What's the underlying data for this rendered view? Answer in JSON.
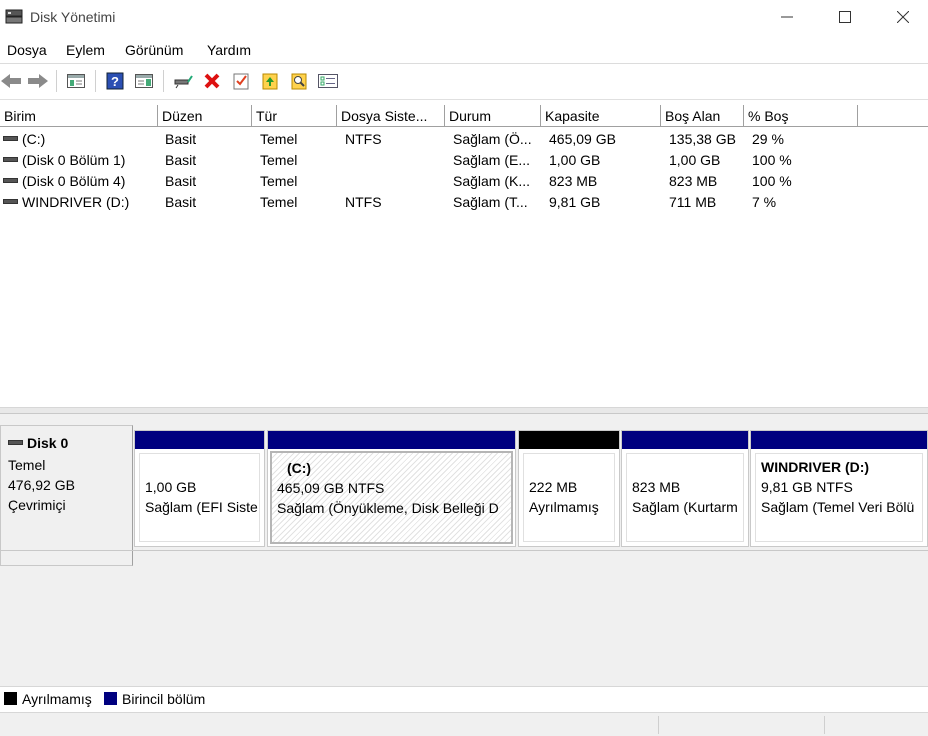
{
  "window": {
    "title": "Disk Yönetimi"
  },
  "menu": [
    "Dosya",
    "Eylem",
    "Görünüm",
    "Yardım"
  ],
  "columns": [
    "Birim",
    "Düzen",
    "Tür",
    "Dosya Siste...",
    "Durum",
    "Kapasite",
    "Boş Alan",
    "% Boş"
  ],
  "volumes": [
    {
      "name": "(C:)",
      "layout": "Basit",
      "type": "Temel",
      "fs": "NTFS",
      "status": "Sağlam (Ö...",
      "capacity": "465,09 GB",
      "free": "135,38 GB",
      "pct": "29 %"
    },
    {
      "name": "(Disk 0 Bölüm 1)",
      "layout": "Basit",
      "type": "Temel",
      "fs": "",
      "status": "Sağlam (E...",
      "capacity": "1,00 GB",
      "free": "1,00 GB",
      "pct": "100 %"
    },
    {
      "name": "(Disk 0 Bölüm 4)",
      "layout": "Basit",
      "type": "Temel",
      "fs": "",
      "status": "Sağlam (K...",
      "capacity": "823 MB",
      "free": "823 MB",
      "pct": "100 %"
    },
    {
      "name": "WINDRIVER (D:)",
      "layout": "Basit",
      "type": "Temel",
      "fs": "NTFS",
      "status": "Sağlam (T...",
      "capacity": "9,81 GB",
      "free": "711 MB",
      "pct": "7 %"
    }
  ],
  "disk": {
    "name": "Disk 0",
    "type": "Temel",
    "size": "476,92 GB",
    "state": "Çevrimiçi"
  },
  "partitions": [
    {
      "title": "",
      "size": "1,00 GB",
      "status": "Sağlam (EFI Siste"
    },
    {
      "title": "(C:)",
      "size": "465,09 GB NTFS",
      "status": "Sağlam (Önyükleme, Disk Belleği D"
    },
    {
      "title": "",
      "size": "222 MB",
      "status": "Ayrılmamış"
    },
    {
      "title": "",
      "size": "823 MB",
      "status": "Sağlam (Kurtarm"
    },
    {
      "title": "WINDRIVER  (D:)",
      "size": "9,81 GB NTFS",
      "status": "Sağlam (Temel Veri Bölü"
    }
  ],
  "legend": {
    "unallocated": "Ayrılmamış",
    "primary": "Birincil bölüm"
  },
  "colors": {
    "primary": "#00007f",
    "unallocated": "#000000"
  },
  "icons": [
    "back-icon",
    "forward-icon",
    "console-tree-icon",
    "help-icon",
    "action-pane-icon",
    "connect-drive-icon",
    "delete-icon",
    "checklist-icon",
    "folder-up-icon",
    "search-folder-icon",
    "properties-icon"
  ]
}
